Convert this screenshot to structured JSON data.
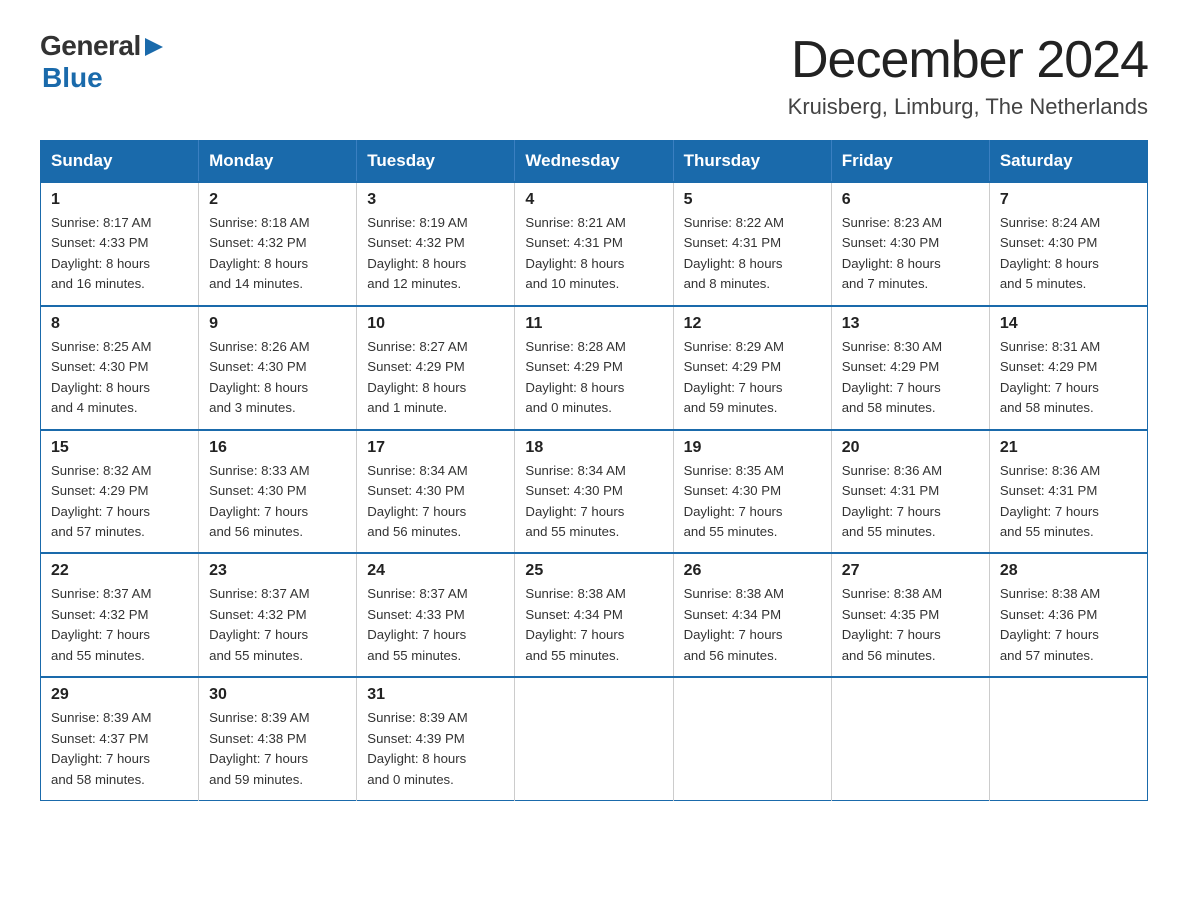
{
  "header": {
    "logo_general": "General",
    "logo_blue": "Blue",
    "month_title": "December 2024",
    "location": "Kruisberg, Limburg, The Netherlands"
  },
  "days_of_week": [
    "Sunday",
    "Monday",
    "Tuesday",
    "Wednesday",
    "Thursday",
    "Friday",
    "Saturday"
  ],
  "weeks": [
    [
      {
        "day": "1",
        "sunrise": "8:17 AM",
        "sunset": "4:33 PM",
        "daylight": "8 hours and 16 minutes."
      },
      {
        "day": "2",
        "sunrise": "8:18 AM",
        "sunset": "4:32 PM",
        "daylight": "8 hours and 14 minutes."
      },
      {
        "day": "3",
        "sunrise": "8:19 AM",
        "sunset": "4:32 PM",
        "daylight": "8 hours and 12 minutes."
      },
      {
        "day": "4",
        "sunrise": "8:21 AM",
        "sunset": "4:31 PM",
        "daylight": "8 hours and 10 minutes."
      },
      {
        "day": "5",
        "sunrise": "8:22 AM",
        "sunset": "4:31 PM",
        "daylight": "8 hours and 8 minutes."
      },
      {
        "day": "6",
        "sunrise": "8:23 AM",
        "sunset": "4:30 PM",
        "daylight": "8 hours and 7 minutes."
      },
      {
        "day": "7",
        "sunrise": "8:24 AM",
        "sunset": "4:30 PM",
        "daylight": "8 hours and 5 minutes."
      }
    ],
    [
      {
        "day": "8",
        "sunrise": "8:25 AM",
        "sunset": "4:30 PM",
        "daylight": "8 hours and 4 minutes."
      },
      {
        "day": "9",
        "sunrise": "8:26 AM",
        "sunset": "4:30 PM",
        "daylight": "8 hours and 3 minutes."
      },
      {
        "day": "10",
        "sunrise": "8:27 AM",
        "sunset": "4:29 PM",
        "daylight": "8 hours and 1 minute."
      },
      {
        "day": "11",
        "sunrise": "8:28 AM",
        "sunset": "4:29 PM",
        "daylight": "8 hours and 0 minutes."
      },
      {
        "day": "12",
        "sunrise": "8:29 AM",
        "sunset": "4:29 PM",
        "daylight": "7 hours and 59 minutes."
      },
      {
        "day": "13",
        "sunrise": "8:30 AM",
        "sunset": "4:29 PM",
        "daylight": "7 hours and 58 minutes."
      },
      {
        "day": "14",
        "sunrise": "8:31 AM",
        "sunset": "4:29 PM",
        "daylight": "7 hours and 58 minutes."
      }
    ],
    [
      {
        "day": "15",
        "sunrise": "8:32 AM",
        "sunset": "4:29 PM",
        "daylight": "7 hours and 57 minutes."
      },
      {
        "day": "16",
        "sunrise": "8:33 AM",
        "sunset": "4:30 PM",
        "daylight": "7 hours and 56 minutes."
      },
      {
        "day": "17",
        "sunrise": "8:34 AM",
        "sunset": "4:30 PM",
        "daylight": "7 hours and 56 minutes."
      },
      {
        "day": "18",
        "sunrise": "8:34 AM",
        "sunset": "4:30 PM",
        "daylight": "7 hours and 55 minutes."
      },
      {
        "day": "19",
        "sunrise": "8:35 AM",
        "sunset": "4:30 PM",
        "daylight": "7 hours and 55 minutes."
      },
      {
        "day": "20",
        "sunrise": "8:36 AM",
        "sunset": "4:31 PM",
        "daylight": "7 hours and 55 minutes."
      },
      {
        "day": "21",
        "sunrise": "8:36 AM",
        "sunset": "4:31 PM",
        "daylight": "7 hours and 55 minutes."
      }
    ],
    [
      {
        "day": "22",
        "sunrise": "8:37 AM",
        "sunset": "4:32 PM",
        "daylight": "7 hours and 55 minutes."
      },
      {
        "day": "23",
        "sunrise": "8:37 AM",
        "sunset": "4:32 PM",
        "daylight": "7 hours and 55 minutes."
      },
      {
        "day": "24",
        "sunrise": "8:37 AM",
        "sunset": "4:33 PM",
        "daylight": "7 hours and 55 minutes."
      },
      {
        "day": "25",
        "sunrise": "8:38 AM",
        "sunset": "4:34 PM",
        "daylight": "7 hours and 55 minutes."
      },
      {
        "day": "26",
        "sunrise": "8:38 AM",
        "sunset": "4:34 PM",
        "daylight": "7 hours and 56 minutes."
      },
      {
        "day": "27",
        "sunrise": "8:38 AM",
        "sunset": "4:35 PM",
        "daylight": "7 hours and 56 minutes."
      },
      {
        "day": "28",
        "sunrise": "8:38 AM",
        "sunset": "4:36 PM",
        "daylight": "7 hours and 57 minutes."
      }
    ],
    [
      {
        "day": "29",
        "sunrise": "8:39 AM",
        "sunset": "4:37 PM",
        "daylight": "7 hours and 58 minutes."
      },
      {
        "day": "30",
        "sunrise": "8:39 AM",
        "sunset": "4:38 PM",
        "daylight": "7 hours and 59 minutes."
      },
      {
        "day": "31",
        "sunrise": "8:39 AM",
        "sunset": "4:39 PM",
        "daylight": "8 hours and 0 minutes."
      },
      null,
      null,
      null,
      null
    ]
  ],
  "labels": {
    "sunrise": "Sunrise:",
    "sunset": "Sunset:",
    "daylight": "Daylight:"
  }
}
